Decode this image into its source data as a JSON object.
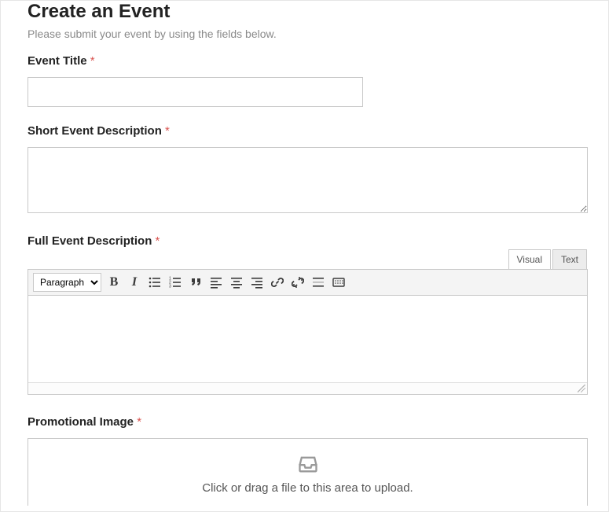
{
  "header": {
    "title": "Create an Event",
    "subtitle": "Please submit your event by using the fields below."
  },
  "fields": {
    "event_title": {
      "label": "Event Title",
      "required_marker": "*",
      "value": ""
    },
    "short_desc": {
      "label": "Short Event Description",
      "required_marker": "*",
      "value": ""
    },
    "full_desc": {
      "label": "Full Event Description",
      "required_marker": "*",
      "value": ""
    },
    "promo_image": {
      "label": "Promotional Image",
      "required_marker": "*"
    }
  },
  "editor": {
    "tabs": {
      "visual": "Visual",
      "text": "Text",
      "active": "visual"
    },
    "format_selected": "Paragraph",
    "buttons": {
      "bold": "B",
      "italic": "I"
    }
  },
  "uploader": {
    "instruction": "Click or drag a file to this area to upload."
  }
}
